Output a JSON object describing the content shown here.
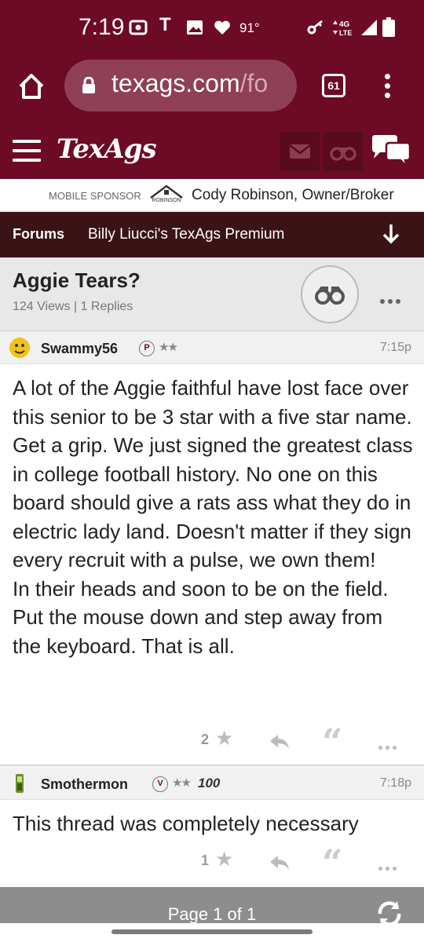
{
  "status_bar": {
    "time": "7:19",
    "temperature": "91°",
    "network": "4G LTE"
  },
  "browser": {
    "url_main": "texags.com",
    "url_rest": "/fo",
    "tab_count": "61"
  },
  "site": {
    "logo": "TexAgs"
  },
  "sponsor": {
    "label": "MOBILE SPONSOR",
    "logo_text": "ROBINSON",
    "name": "Cody Robinson, Owner/Broker"
  },
  "forums_bar": {
    "forums_label": "Forums",
    "board_title": "Billy Liucci's TexAgs Premium"
  },
  "thread": {
    "title": "Aggie Tears?",
    "meta": "124 Views | 1 Replies"
  },
  "posts": [
    {
      "username": "Swammy56",
      "badge": "P",
      "stars": "★★",
      "tag": "",
      "time": "7:15p",
      "body": "A lot of the Aggie faithful have lost face over this senior to be 3 star with a five star name. Get a grip. We just signed the greatest class in college football history. No one on this board should give a rats ass what they do in electric lady land. Doesn't matter if they sign every recruit with a pulse, we own them!\nIn their heads and soon to be on the field. Put the mouse down and step away from the keyboard. That is all.",
      "star_count": "2"
    },
    {
      "username": "Smothermon",
      "badge": "V",
      "stars": "★★",
      "tag": "100",
      "time": "7:18p",
      "body": "This thread was completely necessary",
      "star_count": "1"
    }
  ],
  "pager": {
    "text": "Page 1 of 1"
  },
  "colors": {
    "maroon": "#6d0a25",
    "dark_bar": "#3a1317"
  }
}
